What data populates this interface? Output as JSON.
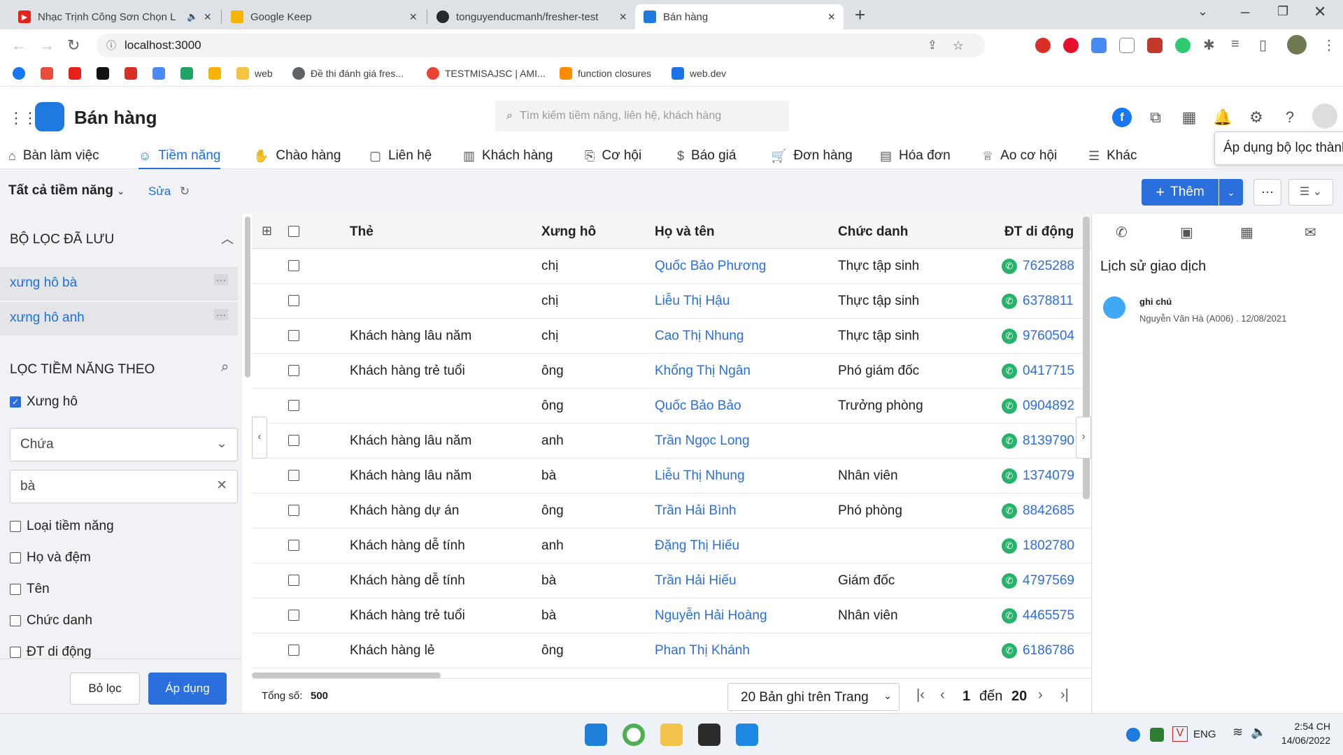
{
  "browser": {
    "tabs": [
      {
        "title": "Nhạc Trịnh Công Sơn Chọn L",
        "color": "#e62117",
        "icon": "youtube-icon"
      },
      {
        "title": "Google Keep",
        "color": "#f6b400",
        "icon": "keep-icon"
      },
      {
        "title": "tonguyenducmanh/fresher-test",
        "color": "#24292e",
        "icon": "github-icon"
      },
      {
        "title": "Bán hàng",
        "color": "#1f7ae0",
        "icon": "app-icon"
      }
    ],
    "url": "localhost:3000",
    "bookmarks": [
      {
        "label": "",
        "color": "#1877f2"
      },
      {
        "label": "",
        "color": "#e84c3d"
      },
      {
        "label": "",
        "color": "#e62117"
      },
      {
        "label": "",
        "color": "#111111"
      },
      {
        "label": "",
        "color": "#d93025"
      },
      {
        "label": "",
        "color": "#4a8af4"
      },
      {
        "label": "",
        "color": "#1fa463"
      },
      {
        "label": "",
        "color": "#f6b400"
      },
      {
        "label": "web",
        "color": "#f5c242"
      },
      {
        "label": "Đề thi đánh giá fres...",
        "color": "#5f6368"
      },
      {
        "label": "TESTMISAJSC | AMI...",
        "color": "#ea4335"
      },
      {
        "label": "function closures",
        "color": "#ff8c00"
      },
      {
        "label": "web.dev",
        "color": "#1a73e8"
      }
    ]
  },
  "app": {
    "title": "Bán hàng",
    "search_placeholder": "Tìm kiếm tiềm năng, liên hệ, khách hàng",
    "menu": [
      "Bàn làm việc",
      "Tiềm năng",
      "Chào hàng",
      "Liên hệ",
      "Khách hàng",
      "Cơ hội",
      "Báo giá",
      "Đơn hàng",
      "Hóa đơn",
      "Ao cơ hội",
      "Khác"
    ],
    "tooltip": "Áp dụng bộ lọc thành"
  },
  "toolbar": {
    "view": "Tất cả tiềm năng",
    "edit": "Sửa",
    "add": "Thêm"
  },
  "sidebar": {
    "saved_title": "BỘ LỌC ĐÃ LƯU",
    "saved": [
      "xưng hô bà",
      "xưng hô anh"
    ],
    "filter_title": "LỌC TIỀM NĂNG THEO",
    "field_checked": "Xưng hô",
    "operator": "Chứa",
    "value": "bà",
    "fields": [
      "Loại tiềm năng",
      "Họ và đệm",
      "Tên",
      "Chức danh",
      "ĐT di động"
    ],
    "reset": "Bỏ lọc",
    "apply": "Áp dụng"
  },
  "grid": {
    "headers": [
      "Thẻ",
      "Xưng hô",
      "Họ và tên",
      "Chức danh",
      "ĐT di động"
    ],
    "rows": [
      {
        "tag": "",
        "salutation": "chị",
        "name": "Quốc Bảo Phương",
        "title": "Thực tập sinh",
        "phone": "7625288"
      },
      {
        "tag": "",
        "salutation": "chị",
        "name": "Liễu Thị Hậu",
        "title": "Thực tập sinh",
        "phone": "6378811"
      },
      {
        "tag": "Khách hàng lâu năm",
        "salutation": "chị",
        "name": "Cao Thị Nhung",
        "title": "Thực tập sinh",
        "phone": "9760504"
      },
      {
        "tag": "Khách hàng trẻ tuổi",
        "salutation": "ông",
        "name": "Khổng Thị Ngân",
        "title": "Phó giám đốc",
        "phone": "0417715"
      },
      {
        "tag": "",
        "salutation": "ông",
        "name": "Quốc Bảo Bảo",
        "title": "Trưởng phòng",
        "phone": "0904892"
      },
      {
        "tag": "Khách hàng lâu năm",
        "salutation": "anh",
        "name": "Trần Ngọc Long",
        "title": "",
        "phone": "8139790"
      },
      {
        "tag": "Khách hàng lâu năm",
        "salutation": "bà",
        "name": "Liễu Thị Nhung",
        "title": "Nhân viên",
        "phone": "1374079"
      },
      {
        "tag": "Khách hàng dự án",
        "salutation": "ông",
        "name": "Trần Hải Bình",
        "title": "Phó phòng",
        "phone": "8842685"
      },
      {
        "tag": "Khách hàng dễ tính",
        "salutation": "anh",
        "name": "Đặng Thị Hiếu",
        "title": "",
        "phone": "1802780"
      },
      {
        "tag": "Khách hàng dễ tính",
        "salutation": "bà",
        "name": "Trần Hải Hiếu",
        "title": "Giám đốc",
        "phone": "4797569"
      },
      {
        "tag": "Khách hàng trẻ tuổi",
        "salutation": "bà",
        "name": "Nguyễn Hải Hoàng",
        "title": "Nhân viên",
        "phone": "4465575"
      },
      {
        "tag": "Khách hàng lẻ",
        "salutation": "ông",
        "name": "Phan Thị Khánh",
        "title": "",
        "phone": "6186786"
      }
    ],
    "total_label": "Tổng số:",
    "total": "500",
    "page_size": "20 Bản ghi trên Trang",
    "from": "1",
    "to_label": "đến",
    "to": "20"
  },
  "right": {
    "title": "Lịch sử giao dịch",
    "item_type": "ghi chú",
    "item_meta": "Nguyễn Văn Hà (A006) . 12/08/2021"
  },
  "taskbar": {
    "lang": "ENG",
    "time": "2:54 CH",
    "date": "14/06/2022"
  }
}
